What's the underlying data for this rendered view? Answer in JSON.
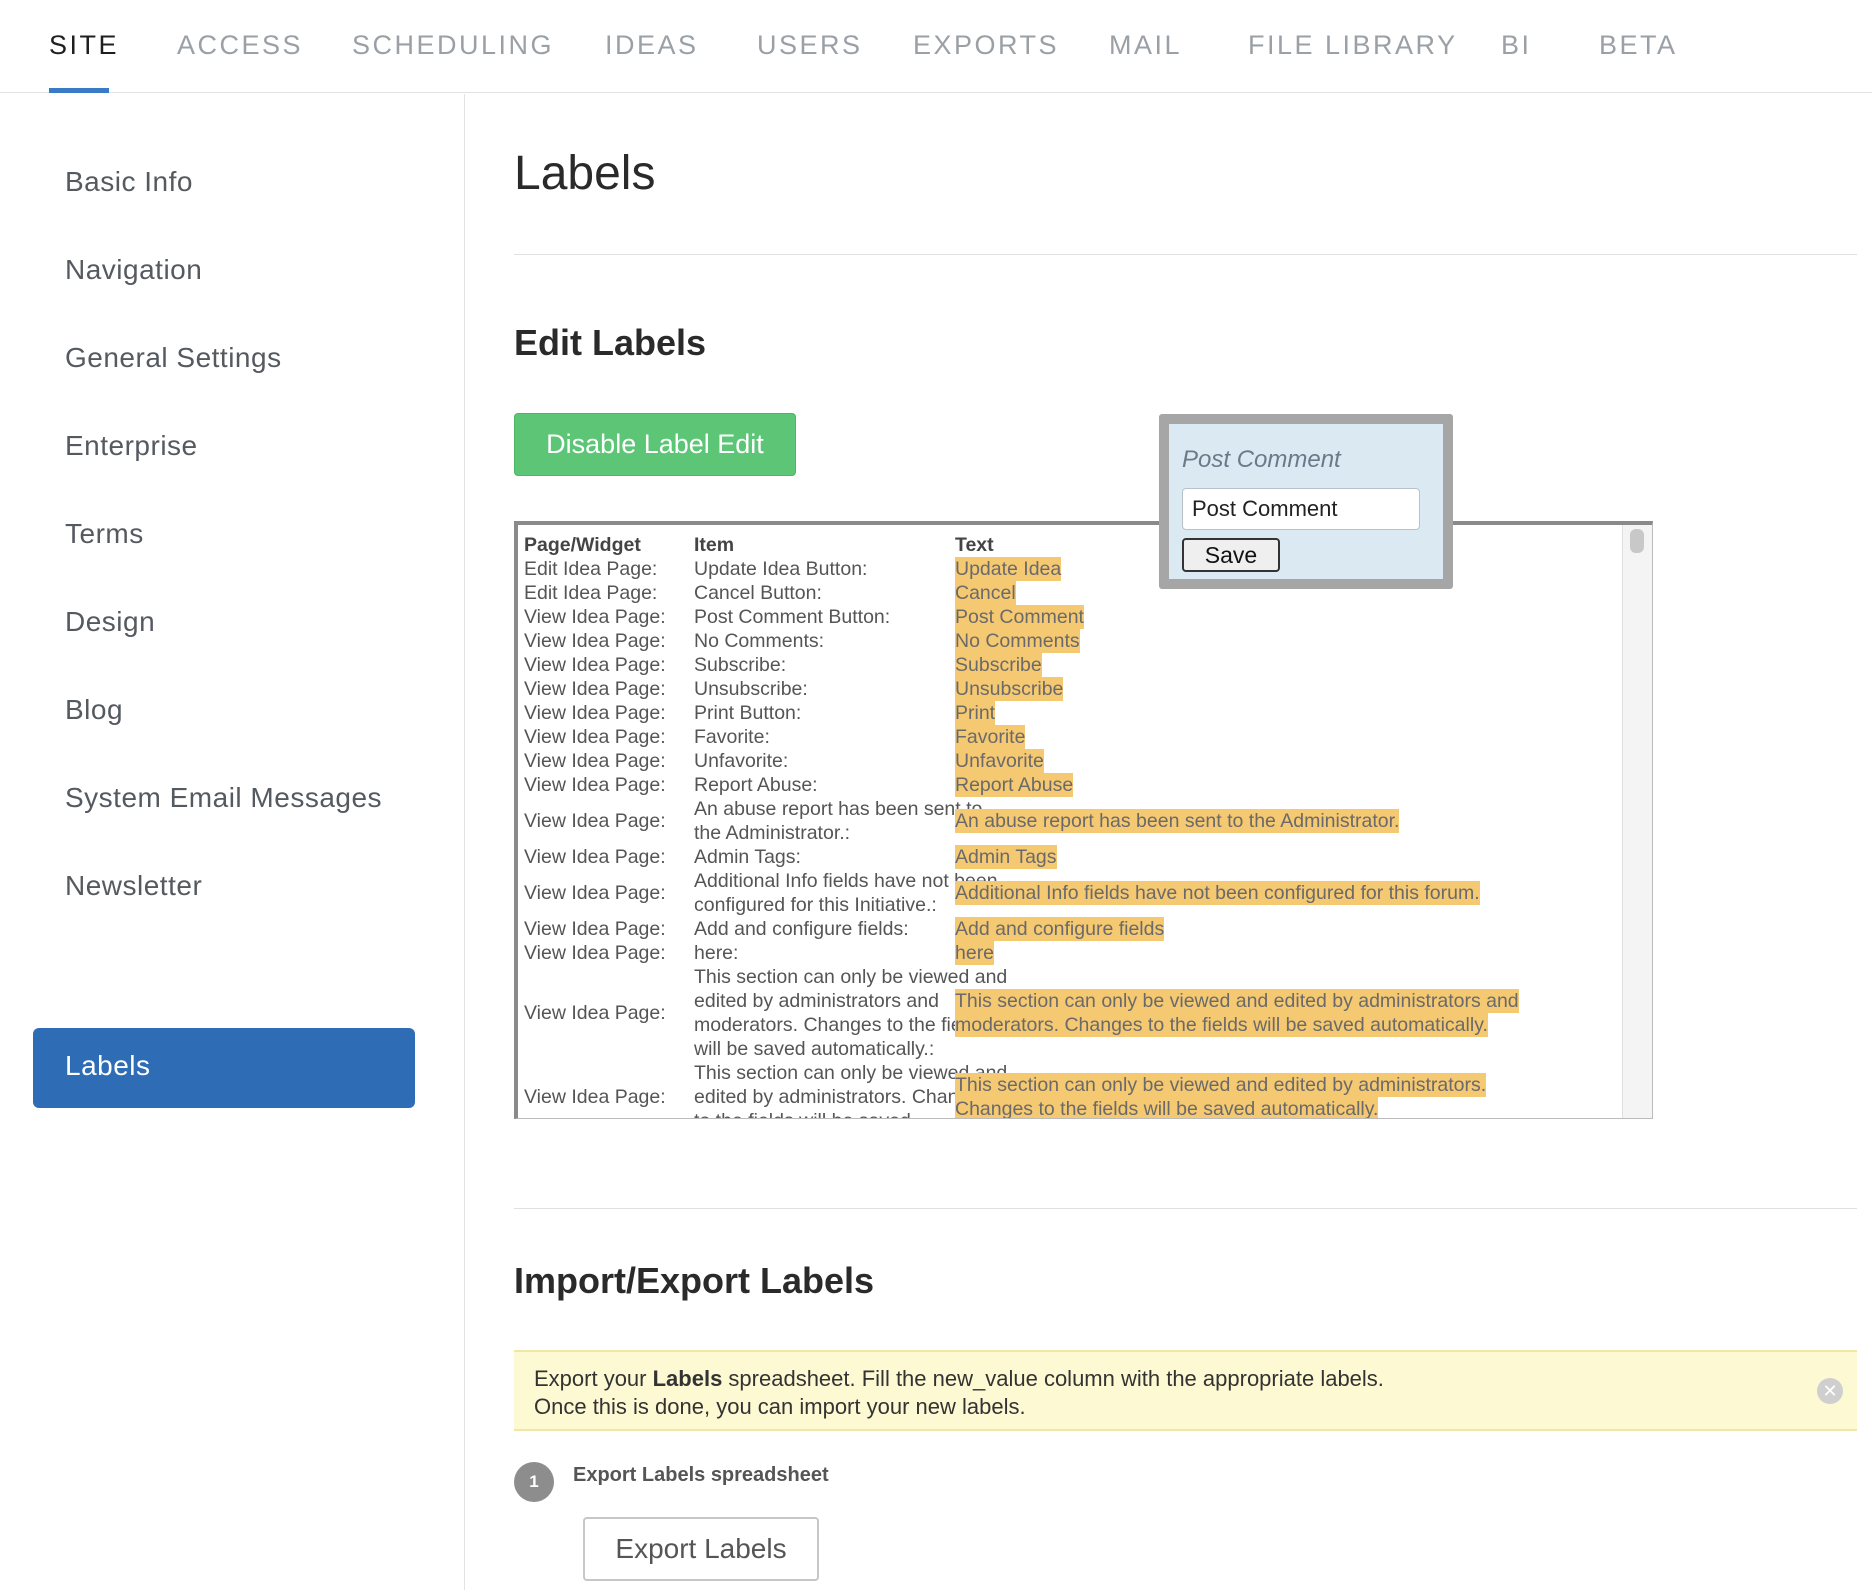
{
  "topnav": {
    "tabs": [
      "SITE",
      "ACCESS",
      "SCHEDULING",
      "IDEAS",
      "USERS",
      "EXPORTS",
      "MAIL",
      "FILE LIBRARY",
      "BI",
      "BETA"
    ],
    "active_tab": "SITE"
  },
  "sidebar": {
    "items": [
      "Basic Info",
      "Navigation",
      "General Settings",
      "Enterprise",
      "Terms",
      "Design",
      "Blog",
      "System Email Messages",
      "Newsletter",
      "Labels"
    ],
    "active_item": "Labels"
  },
  "main": {
    "title": "Labels",
    "edit_section_title": "Edit Labels",
    "disable_button_label": "Disable Label Edit",
    "table": {
      "headers": [
        "Page/Widget",
        "Item",
        "Text"
      ],
      "rows": [
        {
          "page": "Edit Idea Page:",
          "item": [
            "Update Idea Button:"
          ],
          "text": [
            "Update Idea"
          ]
        },
        {
          "page": "Edit Idea Page:",
          "item": [
            "Cancel Button:"
          ],
          "text": [
            "Cancel"
          ]
        },
        {
          "page": "View Idea Page:",
          "item": [
            "Post Comment Button:"
          ],
          "text": [
            "Post Comment"
          ]
        },
        {
          "page": "View Idea Page:",
          "item": [
            "No Comments:"
          ],
          "text": [
            "No Comments"
          ]
        },
        {
          "page": "View Idea Page:",
          "item": [
            "Subscribe:"
          ],
          "text": [
            "Subscribe"
          ]
        },
        {
          "page": "View Idea Page:",
          "item": [
            "Unsubscribe:"
          ],
          "text": [
            "Unsubscribe"
          ]
        },
        {
          "page": "View Idea Page:",
          "item": [
            "Print Button:"
          ],
          "text": [
            "Print"
          ]
        },
        {
          "page": "View Idea Page:",
          "item": [
            "Favorite:"
          ],
          "text": [
            "Favorite"
          ]
        },
        {
          "page": "View Idea Page:",
          "item": [
            "Unfavorite:"
          ],
          "text": [
            "Unfavorite"
          ]
        },
        {
          "page": "View Idea Page:",
          "item": [
            "Report Abuse:"
          ],
          "text": [
            "Report Abuse"
          ]
        },
        {
          "page": "View Idea Page:",
          "item": [
            "An abuse report has been sent to",
            "the Administrator.:"
          ],
          "text": [
            "An abuse report has been sent to the Administrator."
          ]
        },
        {
          "page": "View Idea Page:",
          "item": [
            "Admin Tags:"
          ],
          "text": [
            "Admin Tags"
          ]
        },
        {
          "page": "View Idea Page:",
          "item": [
            "Additional Info fields have not been",
            "configured for this Initiative.:"
          ],
          "text": [
            "Additional Info fields have not been configured for this forum."
          ]
        },
        {
          "page": "View Idea Page:",
          "item": [
            "Add and configure fields:"
          ],
          "text": [
            "Add and configure fields"
          ]
        },
        {
          "page": "View Idea Page:",
          "item": [
            "here:"
          ],
          "text": [
            "here"
          ]
        },
        {
          "page": "View Idea Page:",
          "item": [
            "This section can only be viewed and",
            "edited by administrators and",
            "moderators. Changes to the fields",
            "will be saved automatically.:"
          ],
          "text": [
            "This section can only be viewed and edited by administrators and",
            "moderators. Changes to the fields will be saved automatically."
          ]
        },
        {
          "page": "View Idea Page:",
          "item": [
            "This section can only be viewed and",
            "edited by administrators. Changes",
            "to the fields will be saved"
          ],
          "text": [
            "This section can only be viewed and edited by administrators.",
            "Changes to the fields will be saved automatically."
          ]
        }
      ]
    },
    "popup": {
      "title": "Post Comment",
      "input_value": "Post Comment",
      "save_label": "Save"
    },
    "import_section_title": "Import/Export Labels",
    "info": {
      "line1_prefix": "Export your ",
      "line1_bold": "Labels",
      "line1_suffix": " spreadsheet. Fill the new_value column with the appropriate labels.",
      "line2": "Once this is done, you can import your new labels.",
      "close_icon": "close-circle-icon"
    },
    "step": {
      "number": "1",
      "label": "Export Labels spreadsheet",
      "button_label": "Export Labels"
    }
  },
  "colors": {
    "active_tab_underline": "#3a7bc8",
    "sidebar_active_bg": "#2e6db5",
    "green_button": "#5cc676",
    "label_highlight": "#f5c872",
    "info_bg": "#fdf9d2",
    "popup_bg": "#dbe9f3"
  }
}
